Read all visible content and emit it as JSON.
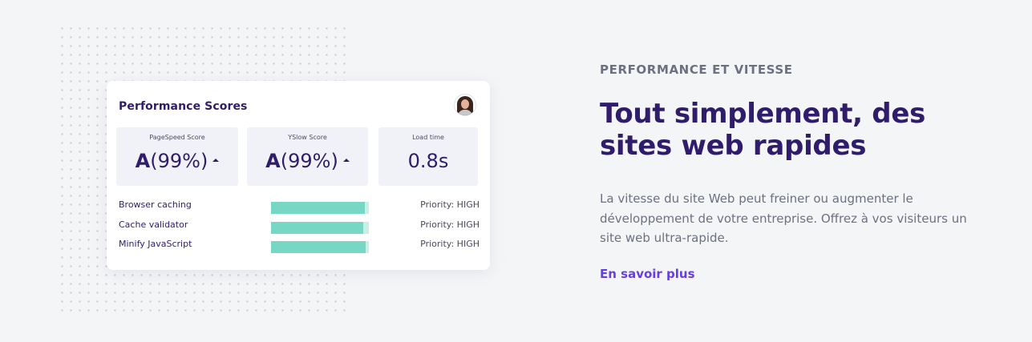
{
  "card": {
    "title": "Performance Scores",
    "scores": [
      {
        "label": "PageSpeed Score",
        "grade": "A",
        "value": "(99%)",
        "trend": "up"
      },
      {
        "label": "YSlow Score",
        "grade": "A",
        "value": "(99%)",
        "trend": "up"
      },
      {
        "label": "Load time",
        "grade": "",
        "value": "0.8s",
        "trend": ""
      }
    ],
    "metrics": [
      {
        "name": "Browser caching",
        "priority": "Priority: HIGH",
        "level": 0.96
      },
      {
        "name": "Cache validator",
        "priority": "Priority: HIGH",
        "level": 0.94
      },
      {
        "name": "Minify JavaScript",
        "priority": "Priority: HIGH",
        "level": 0.97
      }
    ]
  },
  "section": {
    "eyebrow": "PERFORMANCE ET VITESSE",
    "headline": "Tout simplement, des sites web rapides",
    "description": "La vitesse du site Web peut freiner ou augmenter le développement de votre entreprise. Offrez à vos visiteurs un site web ultra-rapide.",
    "cta": "En savoir plus"
  },
  "colors": {
    "brand_dark": "#2f1c6a",
    "accent": "#673de6",
    "bar_fill": "#76d7c4",
    "bar_track": "#c9efe5",
    "muted_text": "#6d7081"
  }
}
